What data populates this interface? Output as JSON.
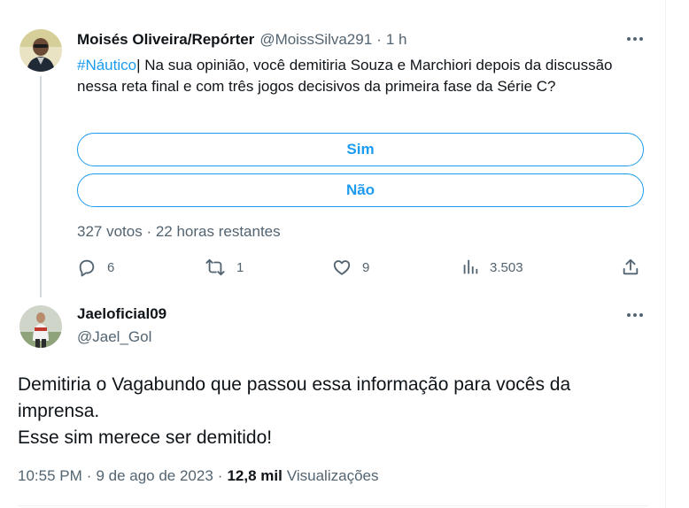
{
  "tweet1": {
    "author_name": "Moisés Oliveira/Repórter",
    "handle": "@MoissSilva291",
    "separator": "·",
    "time": "1 h",
    "hashtag": "#Náutico",
    "text_rest": "| Na sua opinião, você demitiria Souza e Marchiori depois da discussão nessa reta final e com três jogos decisivos da primeira fase da Série C?",
    "poll": {
      "options": [
        "Sim",
        "Não"
      ],
      "meta": "327 votos · 22 horas restantes"
    },
    "actions": {
      "replies": "6",
      "retweets": "1",
      "likes": "9",
      "views": "3.503"
    }
  },
  "tweet2": {
    "author_name": "Jaeloficial09",
    "handle": "@Jael_Gol",
    "lines": [
      "Demitiria o Vagabundo que passou essa informação para vocês da",
      "imprensa.",
      "Esse sim merece ser demitido!"
    ],
    "time": "10:55 PM",
    "date": "9 de ago de 2023",
    "separator": "·",
    "views_count": "12,8 mil",
    "views_label": "Visualizações"
  },
  "colors": {
    "accent": "#1d9bf0",
    "secondary_text": "#536471",
    "primary_text": "#0f1419",
    "thread_line": "#cfd9de"
  },
  "icons": [
    "more-icon",
    "reply-icon",
    "retweet-icon",
    "like-icon",
    "views-icon",
    "share-icon"
  ]
}
